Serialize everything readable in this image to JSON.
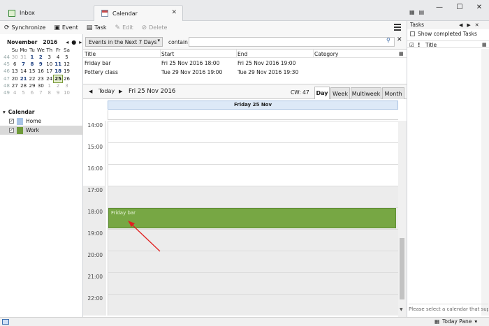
{
  "tabs": [
    {
      "label": "Inbox"
    },
    {
      "label": "Calendar"
    }
  ],
  "toolbar": {
    "sync": "Synchronize",
    "event": "Event",
    "task": "Task",
    "edit": "Edit",
    "delete": "Delete"
  },
  "minimonth": {
    "month": "November",
    "year": "2016",
    "weekdays": [
      "Su",
      "Mo",
      "Tu",
      "We",
      "Th",
      "Fr",
      "Sa"
    ],
    "weeks": [
      {
        "wk": "44",
        "days": [
          "30",
          "31",
          "1",
          "2",
          "3",
          "4",
          "5"
        ]
      },
      {
        "wk": "45",
        "days": [
          "6",
          "7",
          "8",
          "9",
          "10",
          "11",
          "12"
        ]
      },
      {
        "wk": "46",
        "days": [
          "13",
          "14",
          "15",
          "16",
          "17",
          "18",
          "19"
        ]
      },
      {
        "wk": "47",
        "days": [
          "20",
          "21",
          "22",
          "23",
          "24",
          "25",
          "26"
        ]
      },
      {
        "wk": "48",
        "days": [
          "27",
          "28",
          "29",
          "30",
          "1",
          "2",
          "3"
        ]
      },
      {
        "wk": "49",
        "days": [
          "4",
          "5",
          "6",
          "7",
          "8",
          "9",
          "10"
        ]
      }
    ]
  },
  "calendars": {
    "header": "Calendar",
    "items": [
      {
        "name": "Home",
        "color": "#a8c4e6"
      },
      {
        "name": "Work",
        "color": "#6f9a3a"
      }
    ]
  },
  "filter": {
    "selected": "Events in the Next 7 Days",
    "contain": "contain",
    "search_value": ""
  },
  "eventlist": {
    "columns": [
      "Title",
      "Start",
      "End",
      "Category"
    ],
    "rows": [
      {
        "title": "Friday bar",
        "start": "Fri 25 Nov 2016 18:00",
        "end": "Fri 25 Nov 2016 19:00",
        "category": ""
      },
      {
        "title": "Pottery class",
        "start": "Tue 29 Nov 2016 19:00",
        "end": "Tue 29 Nov 2016 19:30",
        "category": ""
      }
    ]
  },
  "nav": {
    "today": "Today",
    "date": "Fri 25 Nov 2016",
    "cw": "CW: 47",
    "views": [
      "Day",
      "Week",
      "Multiweek",
      "Month"
    ]
  },
  "dayview": {
    "header": "Friday 25 Nov",
    "hours": [
      "14:00",
      "15:00",
      "16:00",
      "17:00",
      "18:00",
      "19:00",
      "20:00",
      "21:00",
      "22:00"
    ],
    "event": {
      "title": "Friday bar",
      "color": "#77a744"
    }
  },
  "tasks": {
    "header": "Tasks",
    "show_completed": "Show completed Tasks",
    "title_col": "Title",
    "message": "Please select a calendar that supports tasks"
  },
  "status": {
    "today_pane": "Today Pane"
  }
}
